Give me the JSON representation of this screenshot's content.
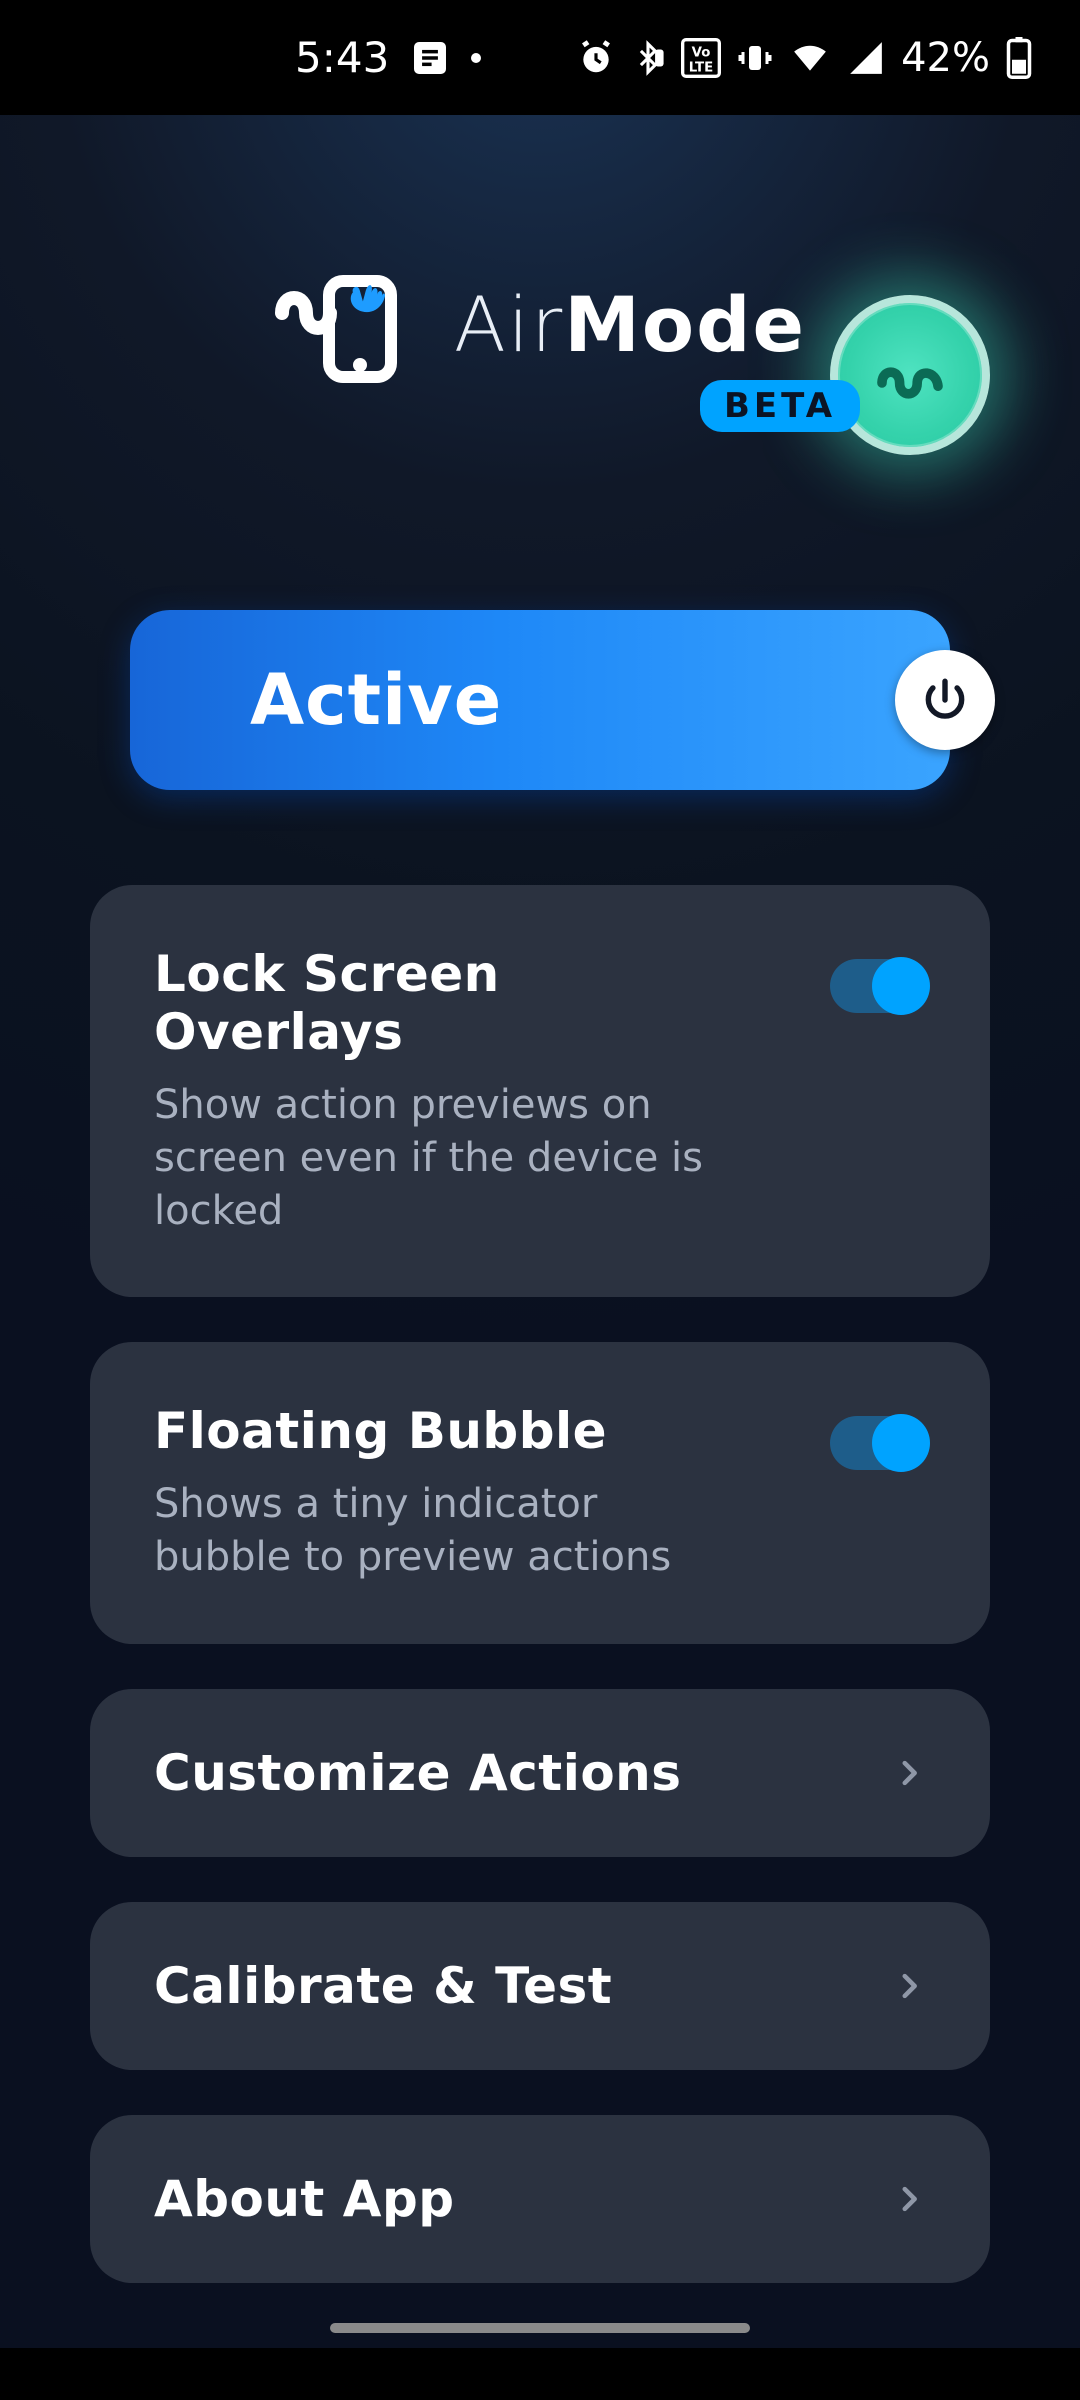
{
  "statusbar": {
    "time": "5:43",
    "battery_pct": "42%"
  },
  "header": {
    "title_thin": "Air",
    "title_bold": "Mode",
    "beta_label": "BETA"
  },
  "active": {
    "label": "Active"
  },
  "cards": {
    "lock_overlay": {
      "title": "Lock Screen Overlays",
      "desc": "Show action previews on screen even if the device is locked",
      "enabled": true
    },
    "floating_bubble": {
      "title": "Floating Bubble",
      "desc": "Shows a tiny indicator bubble to preview actions",
      "enabled": true
    },
    "customize": {
      "title": "Customize Actions"
    },
    "calibrate": {
      "title": "Calibrate & Test"
    },
    "about": {
      "title": "About App"
    }
  },
  "colors": {
    "accent": "#00a3ff",
    "card_bg": "#2b3240",
    "subtext": "#a9b1c0"
  }
}
